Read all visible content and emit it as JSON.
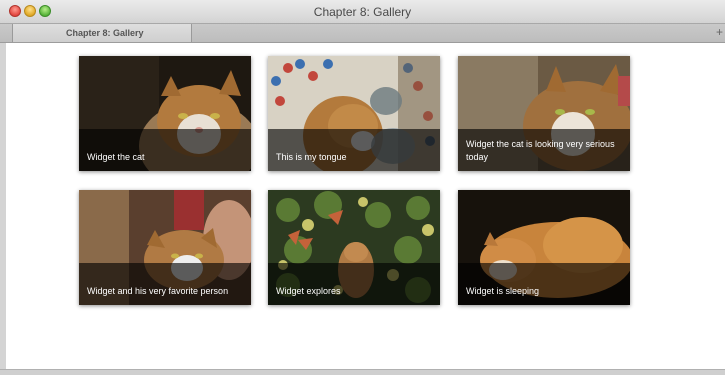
{
  "window": {
    "title": "Chapter 8: Gallery"
  },
  "tabs": [
    {
      "label": "Chapter 8: Gallery"
    }
  ],
  "newtab_icon": "plus-icon",
  "gallery": {
    "items": [
      {
        "caption": "Widget the cat"
      },
      {
        "caption": "This is my tongue"
      },
      {
        "caption": "Widget the cat is looking very serious today"
      },
      {
        "caption": "Widget and his very favorite person"
      },
      {
        "caption": "Widget explores"
      },
      {
        "caption": "Widget is sleeping"
      }
    ]
  }
}
